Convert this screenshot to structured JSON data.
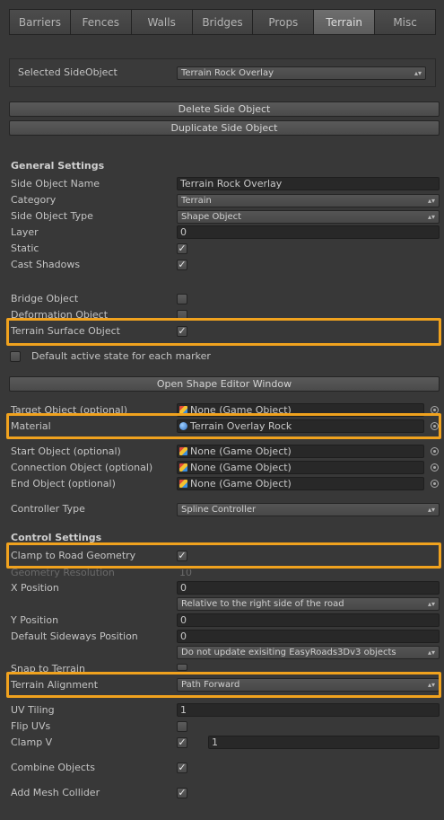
{
  "tabs": [
    "Barriers",
    "Fences",
    "Walls",
    "Bridges",
    "Props",
    "Terrain",
    "Misc"
  ],
  "active_tab": "Terrain",
  "selected": {
    "label": "Selected SideObject",
    "value": "Terrain Rock Overlay"
  },
  "buttons": {
    "delete": "Delete Side Object",
    "duplicate": "Duplicate Side Object",
    "open_shape_editor": "Open Shape Editor Window"
  },
  "general": {
    "header": "General Settings",
    "name_label": "Side Object Name",
    "name_value": "Terrain Rock Overlay",
    "category_label": "Category",
    "category_value": "Terrain",
    "type_label": "Side Object Type",
    "type_value": "Shape Object",
    "layer_label": "Layer",
    "layer_value": "0",
    "static_label": "Static",
    "static_checked": true,
    "shadows_label": "Cast Shadows",
    "shadows_checked": true
  },
  "flags": {
    "bridge_label": "Bridge Object",
    "bridge_checked": false,
    "deformation_label": "Deformation Object",
    "deformation_checked": false,
    "terrain_surface_label": "Terrain Surface Object",
    "terrain_surface_checked": true,
    "default_active_label": "Default active state for each marker",
    "default_active_checked": false
  },
  "objects": {
    "target_label": "Target Object (optional)",
    "target_value": "None (Game Object)",
    "material_label": "Material",
    "material_value": "Terrain Overlay Rock",
    "start_label": "Start Object (optional)",
    "start_value": "None (Game Object)",
    "connection_label": "Connection Object (optional)",
    "connection_value": "None (Game Object)",
    "end_label": "End Object (optional)",
    "end_value": "None (Game Object)",
    "controller_label": "Controller Type",
    "controller_value": "Spline Controller"
  },
  "control": {
    "header": "Control Settings",
    "clamp_label": "Clamp to Road Geometry",
    "clamp_checked": true,
    "geometry_res_label": "Geometry Resolution",
    "geometry_res_value": "10",
    "xpos_label": "X Position",
    "xpos_value": "0",
    "relative_value": "Relative to the right side of the road",
    "ypos_label": "Y Position",
    "ypos_value": "0",
    "sideways_label": "Default Sideways Position",
    "sideways_value": "0",
    "update_value": "Do not update exisiting EasyRoads3Dv3 objects",
    "snap_label": "Snap to Terrain",
    "snap_checked": false,
    "alignment_label": "Terrain Alignment",
    "alignment_value": "Path Forward",
    "uv_tiling_label": "UV Tiling",
    "uv_tiling_value": "1",
    "flip_uvs_label": "Flip UVs",
    "flip_uvs_checked": false,
    "clamp_v_label": "Clamp V",
    "clamp_v_checked": true,
    "clamp_v_value": "1",
    "combine_label": "Combine Objects",
    "combine_checked": true,
    "collider_label": "Add Mesh Collider",
    "collider_checked": true
  },
  "highlight_color": "#f0a21e"
}
